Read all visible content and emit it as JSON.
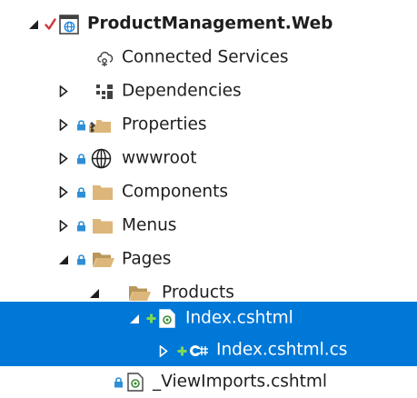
{
  "colors": {
    "selection": "#0078d7",
    "text": "#1e1e1e",
    "selected_text": "#ffffff",
    "folder": "#dcb67a",
    "lock": "#2e8fd6",
    "check": "#d13438",
    "add": "#388a34",
    "globe": "#1e1e1e"
  },
  "tree": {
    "project": {
      "label": "ProductManagement.Web",
      "icons": [
        "collapse-triangle-icon",
        "checkmark-icon",
        "web-project-icon"
      ]
    },
    "items": [
      {
        "label": "Connected Services",
        "icon": "connected-services-icon"
      },
      {
        "label": "Dependencies",
        "icon": "dependencies-icon",
        "expander": "expand"
      },
      {
        "label": "Properties",
        "icon": "properties-folder-icon",
        "expander": "expand",
        "lock": true
      },
      {
        "label": "wwwroot",
        "icon": "globe-icon",
        "expander": "expand",
        "lock": true
      },
      {
        "label": "Components",
        "icon": "folder-icon",
        "expander": "expand",
        "lock": true
      },
      {
        "label": "Menus",
        "icon": "folder-icon",
        "expander": "expand",
        "lock": true
      },
      {
        "label": "Pages",
        "icon": "open-folder-icon",
        "expander": "collapse",
        "lock": true
      },
      {
        "label": "Products",
        "icon": "open-folder-icon",
        "expander": "collapse"
      },
      {
        "label": "Index.cshtml",
        "icon": "razor-file-icon",
        "expander": "collapse",
        "add": true,
        "selected": true
      },
      {
        "label": "Index.cshtml.cs",
        "icon": "csharp-file-icon",
        "expander": "expand",
        "add": true,
        "selected": true
      },
      {
        "label": "_ViewImports.cshtml",
        "icon": "razor-file-icon",
        "lock": true
      }
    ]
  }
}
